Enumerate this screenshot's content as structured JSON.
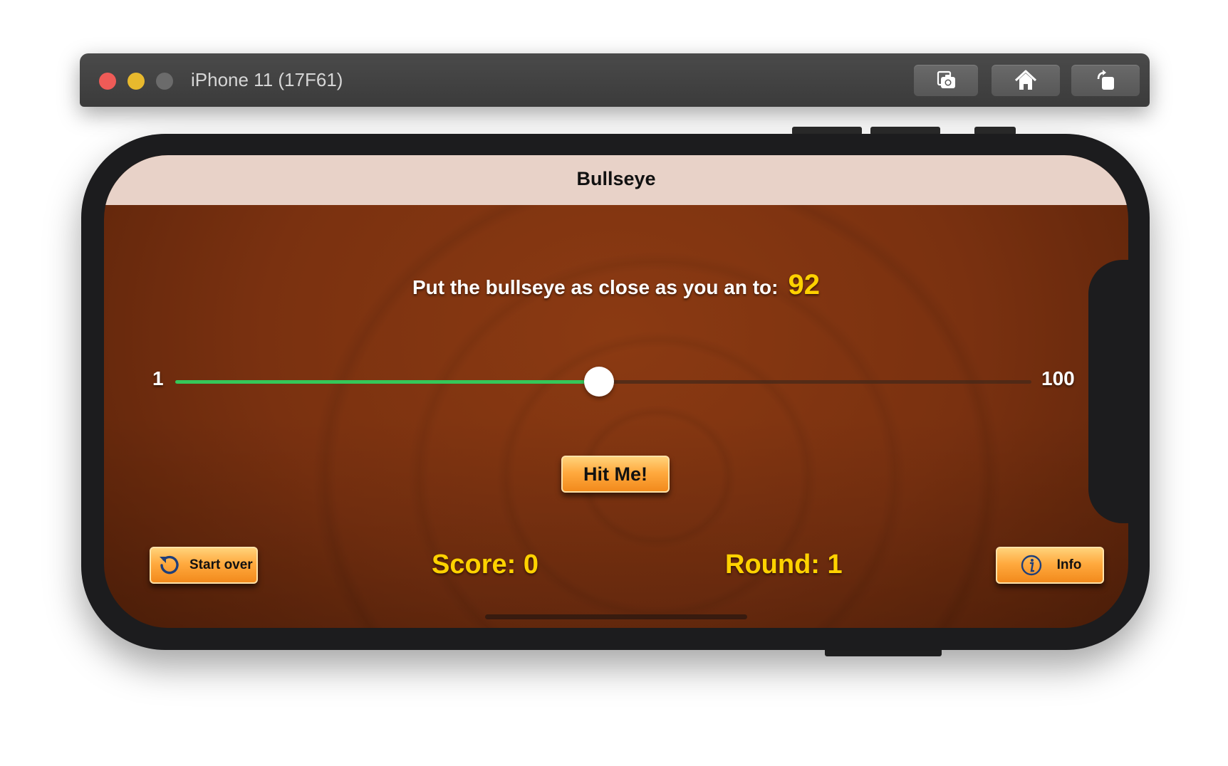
{
  "simulator": {
    "window_title": "iPhone 11 (17F61)",
    "toolbar": {
      "screenshot_icon": "camera-icon",
      "home_icon": "home-icon",
      "rotate_icon": "rotate-icon"
    }
  },
  "app": {
    "nav_title": "Bullseye",
    "target_label": "Put the bullseye as close as you an to:",
    "target_value": "92",
    "slider": {
      "min_label": "1",
      "max_label": "100",
      "min": 1,
      "max": 100,
      "value": 50,
      "fill_color": "#35c759"
    },
    "hit_button_label": "Hit Me!",
    "start_over_label": "Start over",
    "start_over_icon": "restart-icon",
    "score_text": "Score: 0",
    "round_text": "Round: 1",
    "info_label": "Info",
    "info_icon": "info-icon"
  },
  "colors": {
    "accent_yellow": "#ffd200",
    "button_orange": "#ffaa3f",
    "wood_brown": "#7a3110",
    "navbar_bg": "#e8d2c8"
  }
}
